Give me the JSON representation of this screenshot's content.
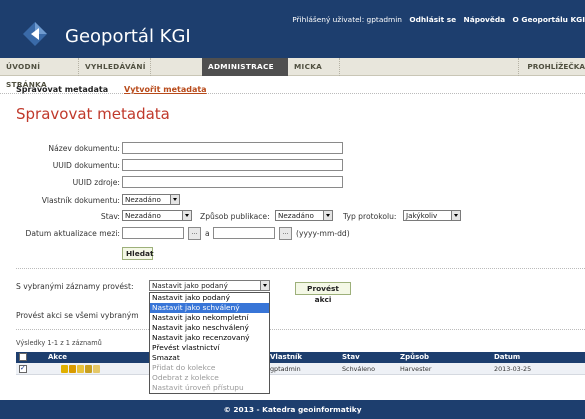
{
  "header": {
    "title": "Geoportál KGI",
    "user_text": "Přihlášený uživatel: gptadmin",
    "logout": "Odhlásit se",
    "help": "Nápověda",
    "about": "O Geoportálu KGI",
    "bg_color": "#1d3e6e"
  },
  "nav": {
    "tabs": [
      "ÚVODNÍ STRÁNKA",
      "VYHLEDÁVÁNÍ",
      "ADMINISTRACE",
      "MICKA"
    ],
    "right": "PROHLÍŽEČKA",
    "active_index": 2
  },
  "subnav": {
    "manage": "Spravovat metadata",
    "create": "Vytvořit metadata"
  },
  "page_title": "Spravovat metadata",
  "form": {
    "name_label": "Název dokumentu:",
    "uuid_label": "UUID dokumentu:",
    "source_uuid_label": "UUID zdroje:",
    "owner_label": "Vlastník dokumentu:",
    "owner_value": "Nezadáno",
    "status_label": "Stav:",
    "status_value": "Nezadáno",
    "publish_label": "Způsob publikace:",
    "publish_value": "Nezadáno",
    "protocol_label": "Typ protokolu:",
    "protocol_value": "Jakýkoliv",
    "date_label": "Datum aktualizace mezi:",
    "date_and": "a",
    "date_format": "(yyyy-mm-dd)",
    "search_button": "Hledat"
  },
  "actions": {
    "selected_label": "S vybranými záznamy provést:",
    "selected_value": "Nastavit jako podaný",
    "run_button": "Provést akci",
    "all_label": "Provést akci se všemi vybraným",
    "options": [
      {
        "label": "Nastavit jako podaný",
        "state": "normal"
      },
      {
        "label": "Nastavit jako schválený",
        "state": "highlighted"
      },
      {
        "label": "Nastavit jako nekompletní",
        "state": "normal"
      },
      {
        "label": "Nastavit jako neschválený",
        "state": "normal"
      },
      {
        "label": "Nastavit jako recenzovaný",
        "state": "normal"
      },
      {
        "label": "Převést vlastnictví",
        "state": "normal"
      },
      {
        "label": "Smazat",
        "state": "normal"
      },
      {
        "label": "Přidat do kolekce",
        "state": "disabled"
      },
      {
        "label": "Odebrat z kolekce",
        "state": "disabled"
      },
      {
        "label": "Nastavit úroveň přístupu",
        "state": "disabled"
      }
    ]
  },
  "results": {
    "summary": "Výsledky 1-1 z 1 záznamů",
    "columns": [
      "Akce",
      "Vlastník",
      "Stav",
      "Způsob",
      "Datum"
    ],
    "rows": [
      {
        "owner": "gptadmin",
        "status": "Schváleno",
        "method": "Harvester",
        "date": "2013-03-25",
        "checked": true
      }
    ]
  },
  "footer": "© 2013 - Katedra geoinformatiky"
}
